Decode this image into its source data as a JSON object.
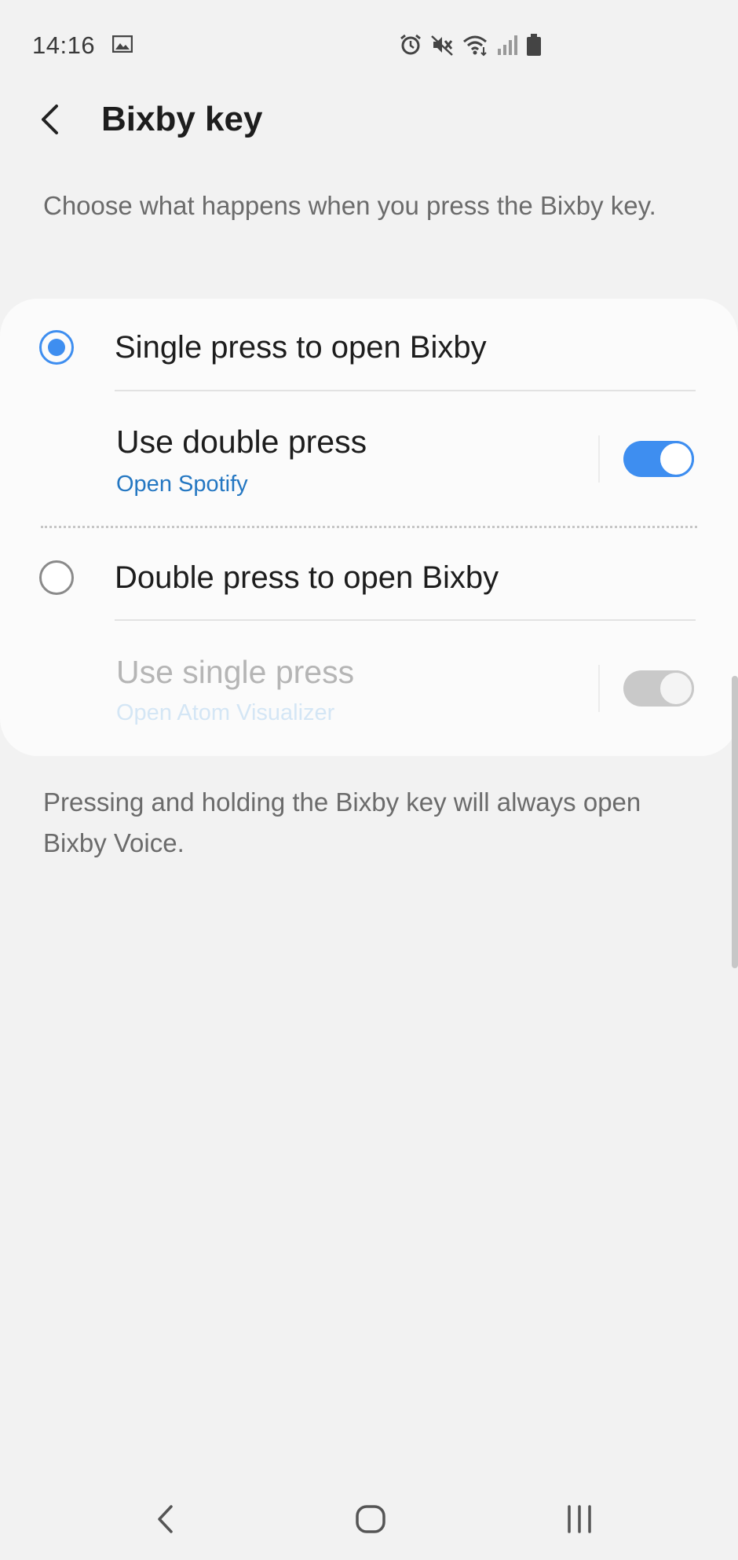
{
  "status_bar": {
    "time": "14:16",
    "icons": [
      "gallery-icon",
      "alarm-icon",
      "mute-icon",
      "wifi-icon",
      "signal-icon",
      "battery-icon"
    ]
  },
  "header": {
    "title": "Bixby key",
    "back_icon": "back-arrow-icon"
  },
  "description": "Choose what happens when you press the Bixby key.",
  "options": [
    {
      "label": "Single press to open Bixby",
      "selected": true,
      "sub_setting": {
        "title": "Use double press",
        "caption": "Open Spotify",
        "toggle_on": true,
        "enabled": true
      }
    },
    {
      "label": "Double press to open Bixby",
      "selected": false,
      "sub_setting": {
        "title": "Use single press",
        "caption": "Open Atom Visualizer",
        "toggle_on": true,
        "enabled": false
      }
    }
  ],
  "footer_note": "Pressing and holding the Bixby key will always open Bixby Voice.",
  "nav_bar": {
    "buttons": [
      "back-icon",
      "home-icon",
      "recents-icon"
    ]
  },
  "colors": {
    "accent": "#3e8ef0",
    "link": "#2477c2",
    "background": "#f2f2f2",
    "card": "#fbfbfb"
  }
}
